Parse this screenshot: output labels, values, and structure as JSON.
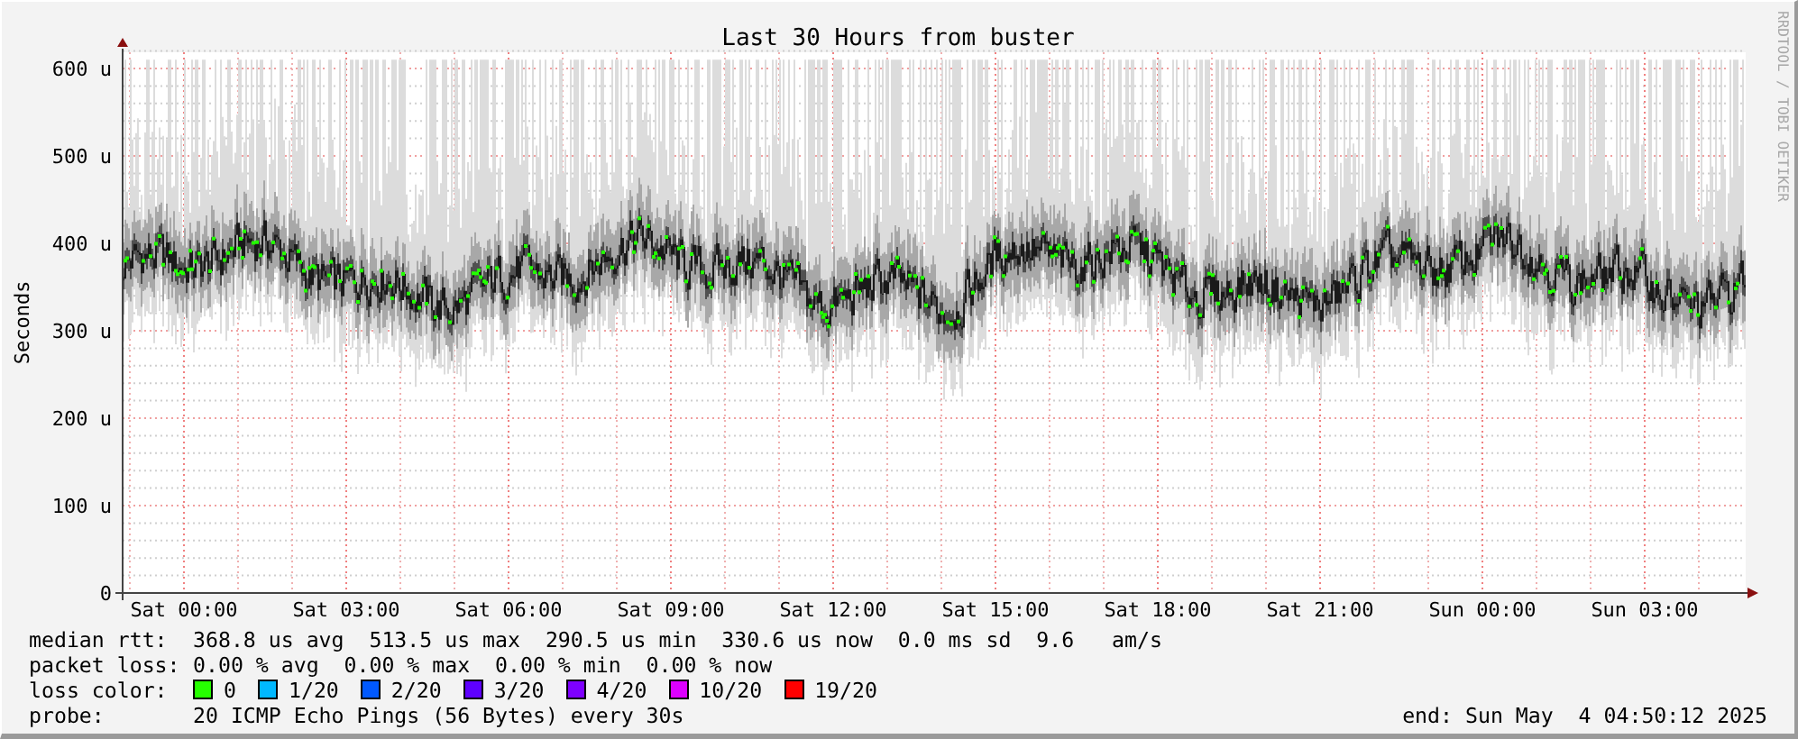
{
  "title": "Last 30 Hours from buster",
  "y_axis_title": "Seconds",
  "watermark_side": "RRDTOOL / TOBI OETIKER",
  "y_ticks": [
    "600 u",
    "500 u",
    "400 u",
    "300 u",
    "200 u",
    "100 u",
    "0"
  ],
  "x_ticks": [
    "Sat 00:00",
    "Sat 03:00",
    "Sat 06:00",
    "Sat 09:00",
    "Sat 12:00",
    "Sat 15:00",
    "Sat 18:00",
    "Sat 21:00",
    "Sun 00:00",
    "Sun 03:00"
  ],
  "legend": [
    {
      "kind": "text",
      "label": "median rtt:",
      "text": "368.8 us avg  513.5 us max  290.5 us min  330.6 us now  0.0 ms sd  9.6   am/s"
    },
    {
      "kind": "text",
      "label": "packet loss:",
      "text": "0.00 % avg  0.00 % max  0.00 % min  0.00 % now"
    },
    {
      "kind": "colors",
      "label": "loss color:",
      "items": [
        {
          "label": "0",
          "color": "#26ff00"
        },
        {
          "label": "1/20",
          "color": "#00b8ff"
        },
        {
          "label": "2/20",
          "color": "#0059ff"
        },
        {
          "label": "3/20",
          "color": "#5e00ff"
        },
        {
          "label": "4/20",
          "color": "#7e00ff"
        },
        {
          "label": "10/20",
          "color": "#dd00ff"
        },
        {
          "label": "19/20",
          "color": "#ff0000"
        }
      ]
    },
    {
      "kind": "text",
      "label": "probe:",
      "text": "20 ICMP Echo Pings (56 Bytes) every 30s"
    }
  ],
  "end": "end: Sun May  4 04:50:12 2025"
}
